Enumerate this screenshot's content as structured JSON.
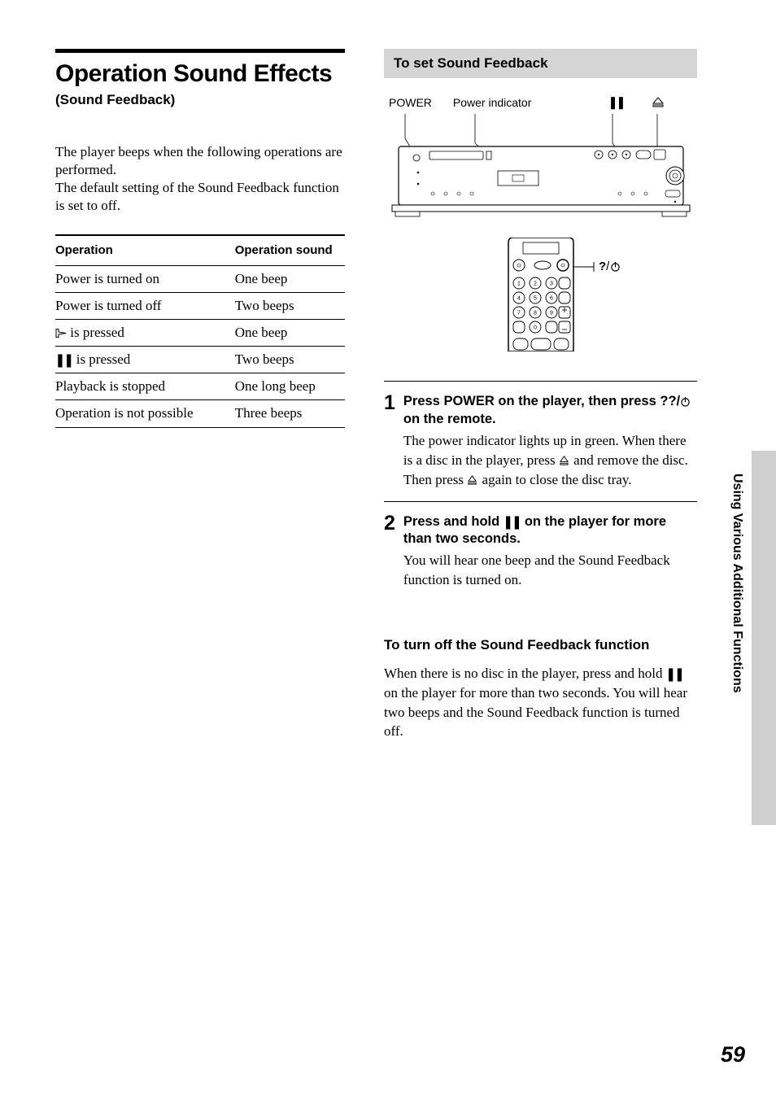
{
  "left": {
    "title": "Operation Sound Effects",
    "subtitle": "(Sound Feedback)",
    "intro": "The player beeps when the following operations are performed.\nThe default setting of the Sound Feedback function is set to off.",
    "table": {
      "headers": [
        "Operation",
        "Operation sound"
      ],
      "rows": [
        {
          "op": "Power is turned on",
          "sound": "One beep"
        },
        {
          "op": "Power is turned off",
          "sound": "Two beeps"
        },
        {
          "op_prefix_icon": "play",
          "op": " is pressed",
          "sound": "One beep"
        },
        {
          "op_prefix_icon": "pause",
          "op": " is pressed",
          "sound": "Two beeps"
        },
        {
          "op": "Playback is stopped",
          "sound": "One long beep"
        },
        {
          "op": "Operation is not possible",
          "sound": "Three beeps"
        }
      ]
    }
  },
  "right": {
    "section_title": "To set Sound Feedback",
    "labels": {
      "power": "POWER",
      "indicator": "Power indicator",
      "onoff": "?/1"
    },
    "steps": [
      {
        "num": "1",
        "head_parts": [
          "Press POWER on the player, then press ",
          "?/",
          " on the remote."
        ],
        "desc_parts": [
          "The power indicator lights up in green. When there is a disc in the player, press ",
          " and remove the disc.  Then press ",
          " again to close the disc tray."
        ]
      },
      {
        "num": "2",
        "head_parts": [
          "Press and hold ",
          " on the player for more than two seconds."
        ],
        "desc": "You will hear one beep and the Sound Feedback function is turned on."
      }
    ],
    "off": {
      "heading": "To turn off the Sound Feedback function",
      "body_parts": [
        "When there is no disc in the player, press and hold ",
        " on the player for more than two seconds. You will hear two beeps and the Sound Feedback function is turned off."
      ]
    }
  },
  "side_tab": "Using Various Additional Functions",
  "page_number": "59"
}
